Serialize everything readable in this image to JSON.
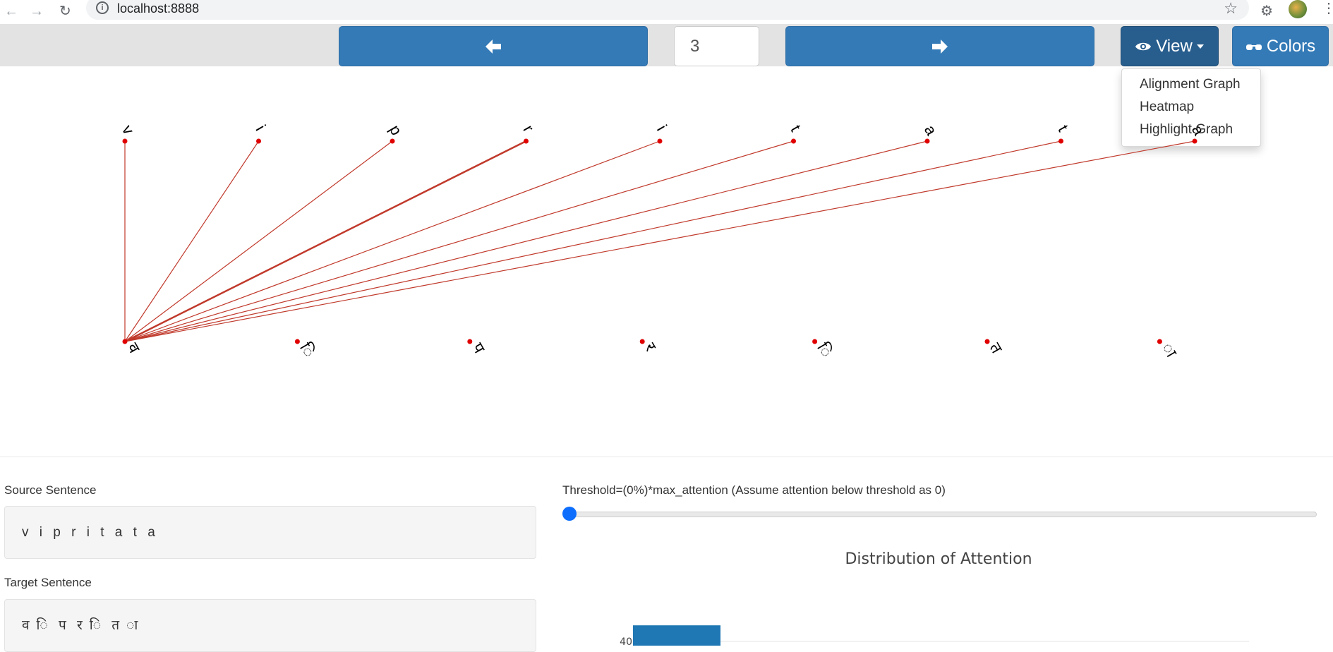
{
  "browser": {
    "url": "localhost:8888",
    "back_icon": "arrow-left-icon",
    "forward_icon": "arrow-right-icon",
    "reload_icon": "reload-icon"
  },
  "toolbar": {
    "prev_icon": "arrow-left-icon",
    "page_number": "3",
    "next_icon": "arrow-right-icon",
    "view_label": "View",
    "colors_label": "Colors",
    "colors": {
      "button": "#337ab7",
      "view_button": "#285e8e"
    }
  },
  "view_menu": {
    "items": [
      "Alignment Graph",
      "Heatmap",
      "Highlight Graph"
    ]
  },
  "alignment_graph": {
    "source_tokens": [
      "v",
      "i",
      "p",
      "r",
      "i",
      "t",
      "a",
      "t",
      "a"
    ],
    "target_tokens": [
      "व",
      "ि",
      "प",
      "र",
      "ि",
      "त",
      "ा"
    ],
    "edge_color": "#c0392b",
    "node_color": "#e00000",
    "edges": [
      {
        "source": 0,
        "target": 0,
        "strong": false
      },
      {
        "source": 1,
        "target": 0,
        "strong": false
      },
      {
        "source": 2,
        "target": 0,
        "strong": false
      },
      {
        "source": 3,
        "target": 0,
        "strong": true
      },
      {
        "source": 4,
        "target": 0,
        "strong": false
      },
      {
        "source": 5,
        "target": 0,
        "strong": false
      },
      {
        "source": 6,
        "target": 0,
        "strong": false
      },
      {
        "source": 7,
        "target": 0,
        "strong": false
      },
      {
        "source": 8,
        "target": 0,
        "strong": false
      }
    ]
  },
  "source_section": {
    "label": "Source Sentence",
    "value": "v i p r i t a t a"
  },
  "target_section": {
    "label": "Target Sentence",
    "value": "व ि प र ि त ा"
  },
  "threshold": {
    "label": "Threshold=(0%)*max_attention (Assume attention below threshold as 0)",
    "value": 0
  },
  "chart_data": {
    "type": "bar",
    "title": "Distribution of Attention",
    "y_ticks": [
      40
    ],
    "values": [
      42
    ],
    "bar_color": "#1f77b4"
  }
}
